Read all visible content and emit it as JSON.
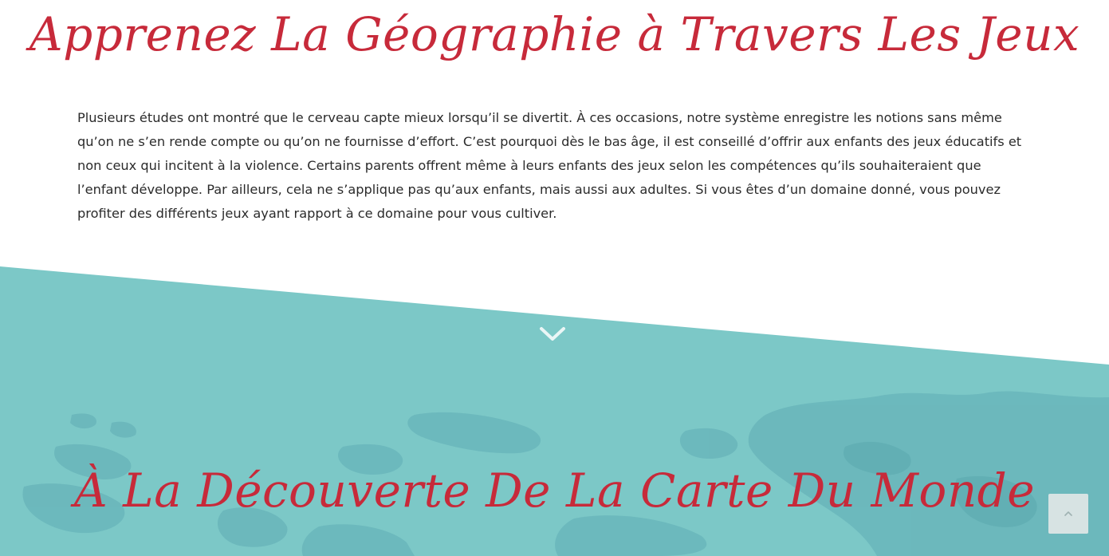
{
  "intro": {
    "title": "Apprenez La Géographie à Travers Les Jeux",
    "paragraph": "Plusieurs études ont montré que le cerveau capte mieux lorsqu’il se divertit. À ces occasions, notre système enregistre les notions sans même qu’on ne s’en rende compte ou qu’on ne fournisse d’effort. C’est pourquoi dès le bas âge, il est conseillé d’offrir aux enfants des jeux éducatifs et non ceux qui incitent à la violence. Certains parents offrent même à leurs enfants des jeux selon les compétences qu’ils souhaiteraient que l’enfant développe. Par ailleurs, cela ne s’applique pas qu’aux enfants, mais aussi aux adultes. Si vous êtes d’un domaine donné, vous pouvez profiter des différents jeux ayant rapport à ce domaine pour vous cultiver."
  },
  "map_section": {
    "title": "À La Découverte De La Carte Du Monde"
  },
  "icons": {
    "scroll_down": "chevron-down-icon",
    "back_to_top": "chevron-up-icon"
  },
  "colors": {
    "heading": "#c72a3a",
    "teal_band": "#7cc8c7",
    "map_shapes": "#6ab6bb",
    "body_text": "#2b2b2b",
    "back_to_top_bg": "#d7e3e3"
  }
}
